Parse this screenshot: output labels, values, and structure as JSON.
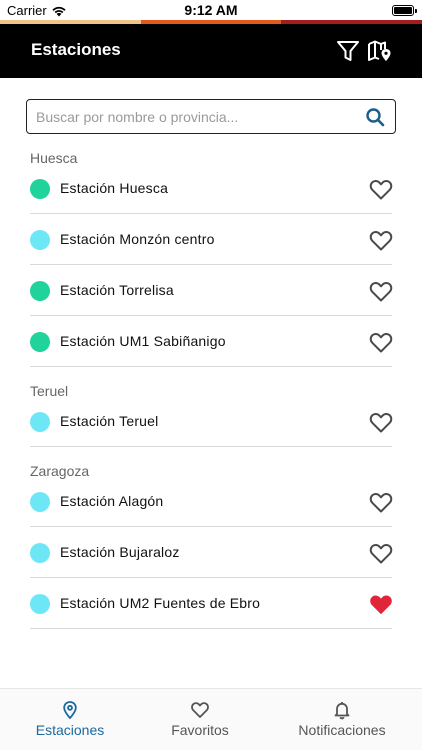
{
  "status_bar": {
    "carrier": "Carrier",
    "time": "9:12 AM"
  },
  "accent_colors": [
    "#f2c48a",
    "#e35a1c",
    "#a11e1e"
  ],
  "header": {
    "title": "Estaciones",
    "filter_icon": "filter-icon",
    "map_icon": "map-pin-icon"
  },
  "search": {
    "placeholder": "Buscar por nombre o provincia...",
    "value": ""
  },
  "colors": {
    "dot_green": "#1fd39b",
    "dot_cyan": "#6de7f6",
    "favorite": "#e0253a",
    "accent_tab": "#1a6aa0"
  },
  "groups": [
    {
      "province": "Huesca",
      "stations": [
        {
          "name": "Estación Huesca",
          "status": "green",
          "favorite": false
        },
        {
          "name": "Estación Monzón centro",
          "status": "cyan",
          "favorite": false
        },
        {
          "name": "Estación Torrelisa",
          "status": "green",
          "favorite": false
        },
        {
          "name": "Estación UM1 Sabiñanigo",
          "status": "green",
          "favorite": false
        }
      ]
    },
    {
      "province": "Teruel",
      "stations": [
        {
          "name": "Estación Teruel",
          "status": "cyan",
          "favorite": false
        }
      ]
    },
    {
      "province": "Zaragoza",
      "stations": [
        {
          "name": "Estación Alagón",
          "status": "cyan",
          "favorite": false
        },
        {
          "name": "Estación Bujaraloz",
          "status": "cyan",
          "favorite": false
        },
        {
          "name": "Estación UM2 Fuentes de Ebro",
          "status": "cyan",
          "favorite": true
        }
      ]
    }
  ],
  "tabs": [
    {
      "label": "Estaciones",
      "icon": "location-pin-icon",
      "active": true
    },
    {
      "label": "Favoritos",
      "icon": "heart-icon",
      "active": false
    },
    {
      "label": "Notificaciones",
      "icon": "bell-icon",
      "active": false
    }
  ]
}
